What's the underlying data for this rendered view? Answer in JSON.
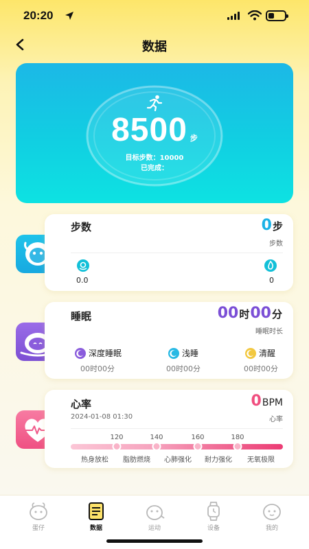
{
  "status_bar": {
    "time": "20:20"
  },
  "header": {
    "title": "数据"
  },
  "hero": {
    "steps": "8500",
    "unit": "步",
    "goal_text": "目标步数：10000",
    "done_text": "已完成："
  },
  "steps_card": {
    "title": "步数",
    "value": "0",
    "unit": "步",
    "sub_label": "步数",
    "distance_value": "0.0",
    "calorie_value": "0"
  },
  "sleep_card": {
    "title": "睡眠",
    "hours": "00",
    "hours_unit": "时",
    "minutes": "00",
    "minutes_unit": "分",
    "sub_label": "睡眠时长",
    "items": [
      {
        "label": "深度睡眠",
        "value": "00时00分",
        "color": "#8a5cdc"
      },
      {
        "label": "浅睡",
        "value": "00时00分",
        "color": "#28b9e4"
      },
      {
        "label": "清醒",
        "value": "00时00分",
        "color": "#f2c840"
      }
    ]
  },
  "heart_card": {
    "title": "心率",
    "value": "0",
    "unit": "BPM",
    "date": "2024-01-08 01:30",
    "sub_label": "心率",
    "ticks": [
      "120",
      "140",
      "160",
      "180"
    ],
    "zones": [
      "热身放松",
      "脂肪燃烧",
      "心肺强化",
      "耐力强化",
      "无氧极限"
    ]
  },
  "tabs": [
    {
      "label": "蛋仔",
      "icon": "egg-pet-icon",
      "active": false
    },
    {
      "label": "数据",
      "icon": "data-report-icon",
      "active": true
    },
    {
      "label": "运动",
      "icon": "sport-icon",
      "active": false
    },
    {
      "label": "设备",
      "icon": "watch-icon",
      "active": false
    },
    {
      "label": "我的",
      "icon": "profile-icon",
      "active": false
    }
  ],
  "colors": {
    "accent_steps": "#1ab2e6",
    "accent_sleep": "#7b4fd6",
    "accent_heart": "#f04e7f",
    "background_top": "#fde66a"
  }
}
